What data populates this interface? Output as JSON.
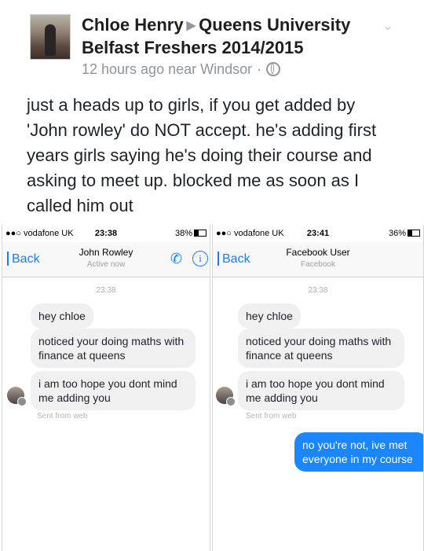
{
  "post": {
    "author": "Chloe Henry",
    "group": "Queens University Belfast Freshers 2014/2015",
    "time": "12 hours ago near Windsor",
    "text": "just a heads up to girls, if you get added by 'John rowley' do NOT accept. he's adding first years girls saying he's doing their course and asking to meet up. blocked me as soon as I called him out"
  },
  "left_shot": {
    "carrier": "●●○ vodafone UK",
    "time": "23:38",
    "battery": "38%",
    "battery_level": 0.38,
    "back_label": "Back",
    "contact_name": "John Rowley",
    "contact_sub": "Active now",
    "timestamp": "23:38",
    "messages": [
      "hey chloe",
      "noticed your doing maths with finance at queens",
      "i am too hope you dont mind me adding you"
    ],
    "sent_from": "Sent from web"
  },
  "right_shot": {
    "carrier": "●●○ vodafone UK",
    "time": "23:41",
    "battery": "36%",
    "battery_level": 0.36,
    "back_label": "Back",
    "contact_name": "Facebook User",
    "contact_sub": "Facebook",
    "timestamp": "23:38",
    "messages": [
      "hey chloe",
      "noticed your doing maths with finance at queens",
      "i am too hope you dont mind me adding you"
    ],
    "sent_from": "Sent from web",
    "reply": "no you're not, ive met everyone in my course"
  },
  "colors": {
    "accent": "#1a86ff",
    "link": "#1a7cf6"
  }
}
